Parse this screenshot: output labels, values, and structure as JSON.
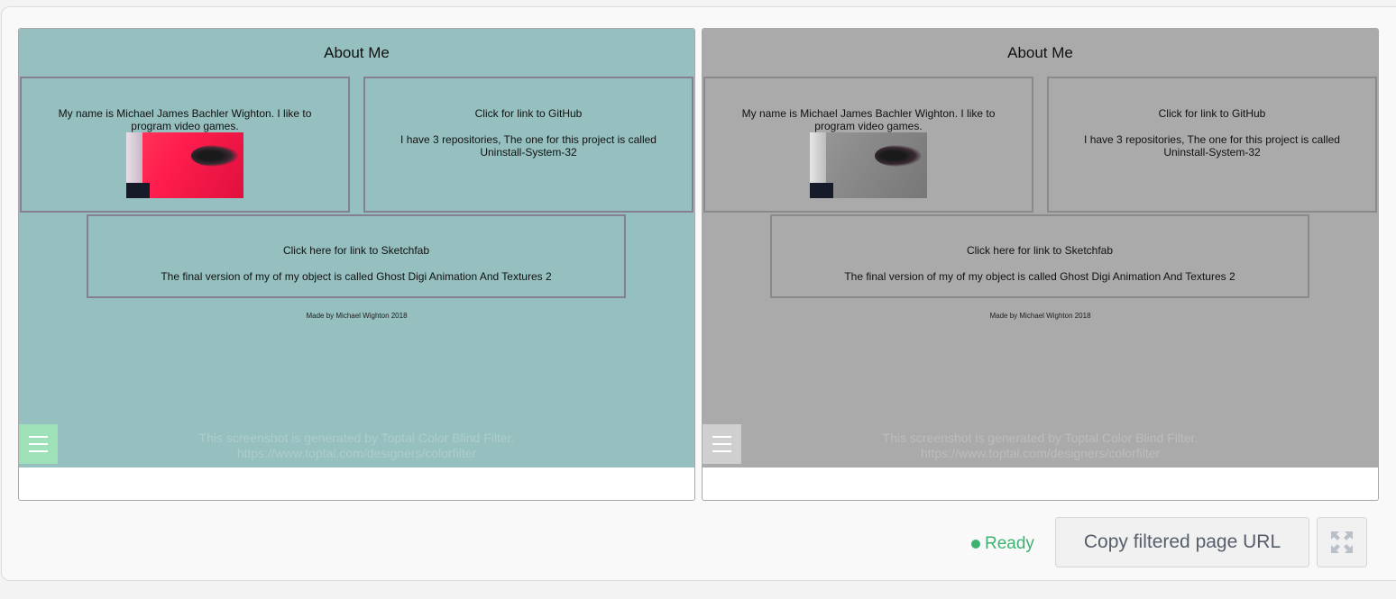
{
  "page": {
    "title": "About Me",
    "intro": "My name is Michael James Bachler Wighton. I like to program video games.",
    "github_link": "Click for link to GitHub",
    "github_desc": "I have 3 repositories, The one for this project is called Uninstall-System-32",
    "sketchfab_link": "Click here for link to Sketchfab",
    "sketchfab_desc": "The final version of my of my object is called Ghost Digi Animation And Textures 2",
    "footer": "Made by Michael Wighton 2018"
  },
  "watermark": {
    "line1": "This screenshot is generated by Toptal Color Blind Filter.",
    "line2": "https://www.toptal.com/designers/colorfilter"
  },
  "toolbar": {
    "status": "Ready",
    "copy_label": "Copy filtered page URL",
    "expand_icon": "expand-icon"
  },
  "colors": {
    "original_bg": "#96bfbf",
    "filtered_bg": "#aaaaaa",
    "status_green": "#3cb371",
    "menu_original": "#9ee0b8",
    "menu_filtered": "#cfcfcf"
  }
}
